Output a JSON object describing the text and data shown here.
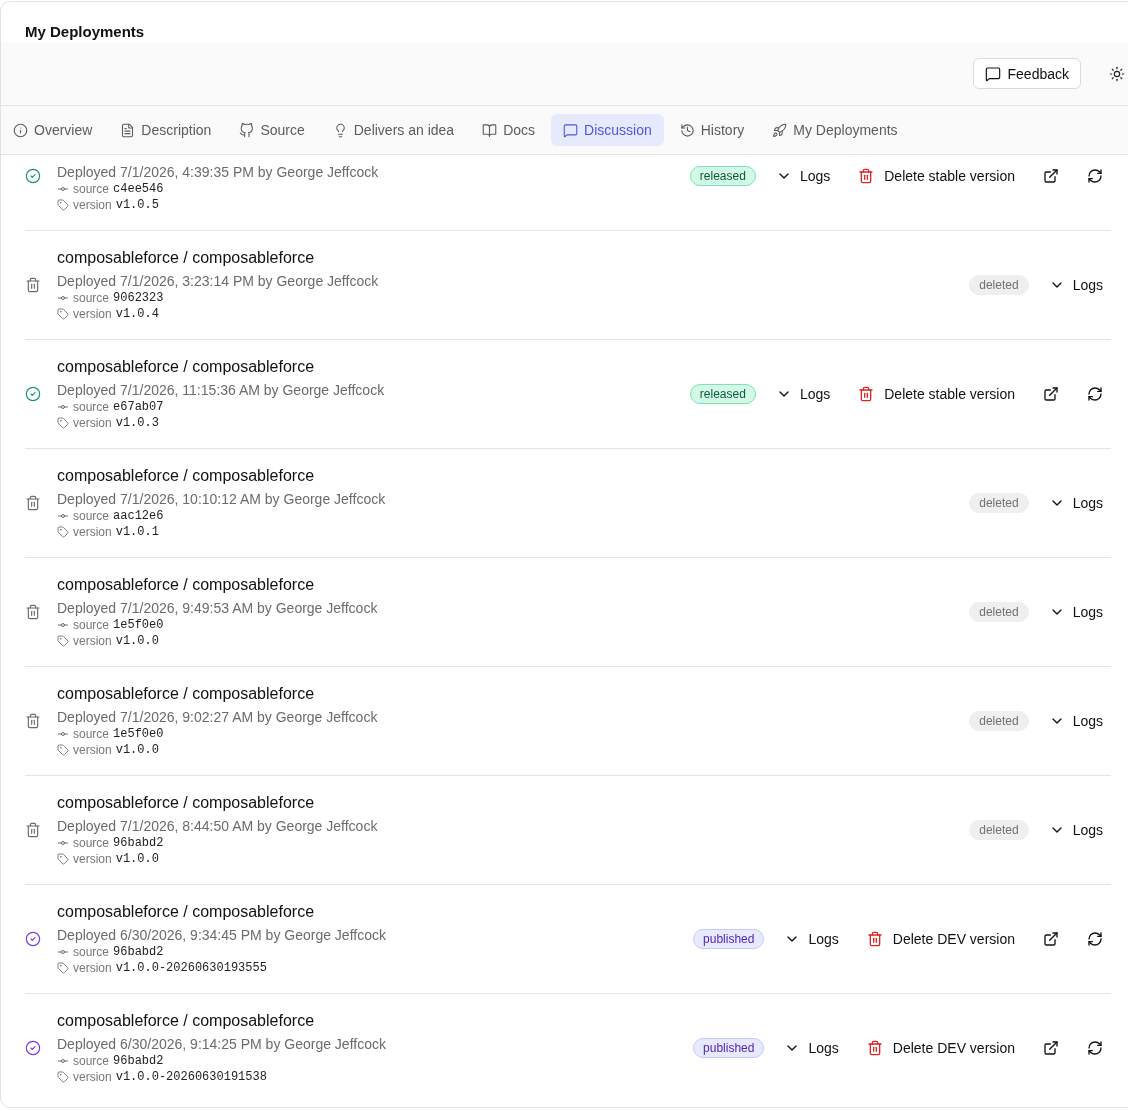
{
  "header": {
    "title": "My Deployments",
    "feedback_button": "Feedback"
  },
  "tabs": [
    {
      "label": "Overview",
      "selected": false
    },
    {
      "label": "Description",
      "selected": false
    },
    {
      "label": "Source",
      "selected": false
    },
    {
      "label": "Delivers an idea",
      "selected": false
    },
    {
      "label": "Docs",
      "selected": false
    },
    {
      "label": "Discussion",
      "selected": true
    },
    {
      "label": "History",
      "selected": false
    },
    {
      "label": "My Deployments",
      "selected": false
    }
  ],
  "deployments": [
    {
      "kind": "released",
      "deployed": "Deployed 7/1/2026, 4:39:35 PM by George Jeffcock",
      "source_label": "source",
      "source": "c4ee546",
      "version_label": "version",
      "version": "v1.0.5",
      "badge": "released",
      "logs_button": "Logs",
      "delete_button": "Delete stable version"
    },
    {
      "kind": "deleted",
      "title": "composableforce / composableforce",
      "deployed": "Deployed 7/1/2026, 3:23:14 PM by George Jeffcock",
      "source_label": "source",
      "source": "9062323",
      "version_label": "version",
      "version": "v1.0.4",
      "badge": "deleted",
      "logs_button": "Logs"
    },
    {
      "kind": "released",
      "title": "composableforce / composableforce",
      "deployed": "Deployed 7/1/2026, 11:15:36 AM by George Jeffcock",
      "source_label": "source",
      "source": "e67ab07",
      "version_label": "version",
      "version": "v1.0.3",
      "badge": "released",
      "logs_button": "Logs",
      "delete_button": "Delete stable version"
    },
    {
      "kind": "deleted",
      "title": "composableforce / composableforce",
      "deployed": "Deployed 7/1/2026, 10:10:12 AM by George Jeffcock",
      "source_label": "source",
      "source": "aac12e6",
      "version_label": "version",
      "version": "v1.0.1",
      "badge": "deleted",
      "logs_button": "Logs"
    },
    {
      "kind": "deleted",
      "title": "composableforce / composableforce",
      "deployed": "Deployed 7/1/2026, 9:49:53 AM by George Jeffcock",
      "source_label": "source",
      "source": "1e5f0e0",
      "version_label": "version",
      "version": "v1.0.0",
      "badge": "deleted",
      "logs_button": "Logs"
    },
    {
      "kind": "deleted",
      "title": "composableforce / composableforce",
      "deployed": "Deployed 7/1/2026, 9:02:27 AM by George Jeffcock",
      "source_label": "source",
      "source": "1e5f0e0",
      "version_label": "version",
      "version": "v1.0.0",
      "badge": "deleted",
      "logs_button": "Logs"
    },
    {
      "kind": "deleted",
      "title": "composableforce / composableforce",
      "deployed": "Deployed 7/1/2026, 8:44:50 AM by George Jeffcock",
      "source_label": "source",
      "source": "96babd2",
      "version_label": "version",
      "version": "v1.0.0",
      "badge": "deleted",
      "logs_button": "Logs"
    },
    {
      "kind": "published",
      "title": "composableforce / composableforce",
      "deployed": "Deployed 6/30/2026, 9:34:45 PM by George Jeffcock",
      "source_label": "source",
      "source": "96babd2",
      "version_label": "version",
      "version": "v1.0.0-20260630193555",
      "badge": "published",
      "logs_button": "Logs",
      "delete_button": "Delete DEV version"
    },
    {
      "kind": "published",
      "title": "composableforce / composableforce",
      "deployed": "Deployed 6/30/2026, 9:14:25 PM by George Jeffcock",
      "source_label": "source",
      "source": "96babd2",
      "version_label": "version",
      "version": "v1.0.0-20260630191538",
      "badge": "published",
      "logs_button": "Logs",
      "delete_button": "Delete DEV version"
    }
  ]
}
